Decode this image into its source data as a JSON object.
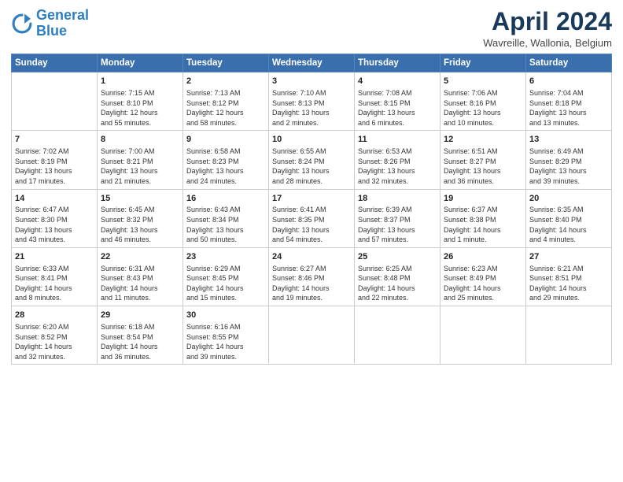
{
  "header": {
    "logo_line1": "General",
    "logo_line2": "Blue",
    "title": "April 2024",
    "location": "Wavreille, Wallonia, Belgium"
  },
  "weekdays": [
    "Sunday",
    "Monday",
    "Tuesday",
    "Wednesday",
    "Thursday",
    "Friday",
    "Saturday"
  ],
  "weeks": [
    [
      {
        "day": "",
        "info": ""
      },
      {
        "day": "1",
        "info": "Sunrise: 7:15 AM\nSunset: 8:10 PM\nDaylight: 12 hours\nand 55 minutes."
      },
      {
        "day": "2",
        "info": "Sunrise: 7:13 AM\nSunset: 8:12 PM\nDaylight: 12 hours\nand 58 minutes."
      },
      {
        "day": "3",
        "info": "Sunrise: 7:10 AM\nSunset: 8:13 PM\nDaylight: 13 hours\nand 2 minutes."
      },
      {
        "day": "4",
        "info": "Sunrise: 7:08 AM\nSunset: 8:15 PM\nDaylight: 13 hours\nand 6 minutes."
      },
      {
        "day": "5",
        "info": "Sunrise: 7:06 AM\nSunset: 8:16 PM\nDaylight: 13 hours\nand 10 minutes."
      },
      {
        "day": "6",
        "info": "Sunrise: 7:04 AM\nSunset: 8:18 PM\nDaylight: 13 hours\nand 13 minutes."
      }
    ],
    [
      {
        "day": "7",
        "info": "Sunrise: 7:02 AM\nSunset: 8:19 PM\nDaylight: 13 hours\nand 17 minutes."
      },
      {
        "day": "8",
        "info": "Sunrise: 7:00 AM\nSunset: 8:21 PM\nDaylight: 13 hours\nand 21 minutes."
      },
      {
        "day": "9",
        "info": "Sunrise: 6:58 AM\nSunset: 8:23 PM\nDaylight: 13 hours\nand 24 minutes."
      },
      {
        "day": "10",
        "info": "Sunrise: 6:55 AM\nSunset: 8:24 PM\nDaylight: 13 hours\nand 28 minutes."
      },
      {
        "day": "11",
        "info": "Sunrise: 6:53 AM\nSunset: 8:26 PM\nDaylight: 13 hours\nand 32 minutes."
      },
      {
        "day": "12",
        "info": "Sunrise: 6:51 AM\nSunset: 8:27 PM\nDaylight: 13 hours\nand 36 minutes."
      },
      {
        "day": "13",
        "info": "Sunrise: 6:49 AM\nSunset: 8:29 PM\nDaylight: 13 hours\nand 39 minutes."
      }
    ],
    [
      {
        "day": "14",
        "info": "Sunrise: 6:47 AM\nSunset: 8:30 PM\nDaylight: 13 hours\nand 43 minutes."
      },
      {
        "day": "15",
        "info": "Sunrise: 6:45 AM\nSunset: 8:32 PM\nDaylight: 13 hours\nand 46 minutes."
      },
      {
        "day": "16",
        "info": "Sunrise: 6:43 AM\nSunset: 8:34 PM\nDaylight: 13 hours\nand 50 minutes."
      },
      {
        "day": "17",
        "info": "Sunrise: 6:41 AM\nSunset: 8:35 PM\nDaylight: 13 hours\nand 54 minutes."
      },
      {
        "day": "18",
        "info": "Sunrise: 6:39 AM\nSunset: 8:37 PM\nDaylight: 13 hours\nand 57 minutes."
      },
      {
        "day": "19",
        "info": "Sunrise: 6:37 AM\nSunset: 8:38 PM\nDaylight: 14 hours\nand 1 minute."
      },
      {
        "day": "20",
        "info": "Sunrise: 6:35 AM\nSunset: 8:40 PM\nDaylight: 14 hours\nand 4 minutes."
      }
    ],
    [
      {
        "day": "21",
        "info": "Sunrise: 6:33 AM\nSunset: 8:41 PM\nDaylight: 14 hours\nand 8 minutes."
      },
      {
        "day": "22",
        "info": "Sunrise: 6:31 AM\nSunset: 8:43 PM\nDaylight: 14 hours\nand 11 minutes."
      },
      {
        "day": "23",
        "info": "Sunrise: 6:29 AM\nSunset: 8:45 PM\nDaylight: 14 hours\nand 15 minutes."
      },
      {
        "day": "24",
        "info": "Sunrise: 6:27 AM\nSunset: 8:46 PM\nDaylight: 14 hours\nand 19 minutes."
      },
      {
        "day": "25",
        "info": "Sunrise: 6:25 AM\nSunset: 8:48 PM\nDaylight: 14 hours\nand 22 minutes."
      },
      {
        "day": "26",
        "info": "Sunrise: 6:23 AM\nSunset: 8:49 PM\nDaylight: 14 hours\nand 25 minutes."
      },
      {
        "day": "27",
        "info": "Sunrise: 6:21 AM\nSunset: 8:51 PM\nDaylight: 14 hours\nand 29 minutes."
      }
    ],
    [
      {
        "day": "28",
        "info": "Sunrise: 6:20 AM\nSunset: 8:52 PM\nDaylight: 14 hours\nand 32 minutes."
      },
      {
        "day": "29",
        "info": "Sunrise: 6:18 AM\nSunset: 8:54 PM\nDaylight: 14 hours\nand 36 minutes."
      },
      {
        "day": "30",
        "info": "Sunrise: 6:16 AM\nSunset: 8:55 PM\nDaylight: 14 hours\nand 39 minutes."
      },
      {
        "day": "",
        "info": ""
      },
      {
        "day": "",
        "info": ""
      },
      {
        "day": "",
        "info": ""
      },
      {
        "day": "",
        "info": ""
      }
    ]
  ]
}
